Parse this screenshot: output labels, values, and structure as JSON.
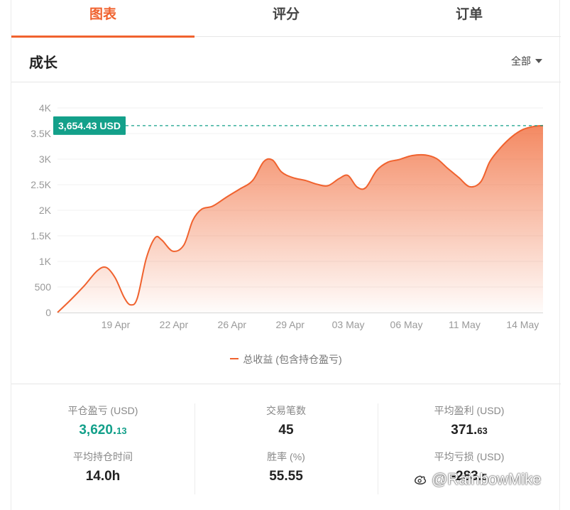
{
  "tabs": [
    {
      "label": "图表",
      "active": true
    },
    {
      "label": "评分",
      "active": false
    },
    {
      "label": "订单",
      "active": false
    }
  ],
  "section": {
    "title": "成长",
    "filter_label": "全部"
  },
  "highlight": {
    "label": "3,654.43 USD",
    "color": "#13a08a"
  },
  "colors": {
    "accent": "#f0622e",
    "positive": "#13a08a"
  },
  "chart_data": {
    "type": "area",
    "ylim": [
      0,
      4000
    ],
    "y_ticks": [
      {
        "v": 0,
        "label": "0"
      },
      {
        "v": 500,
        "label": "500"
      },
      {
        "v": 1000,
        "label": "1K"
      },
      {
        "v": 1500,
        "label": "1.5K"
      },
      {
        "v": 2000,
        "label": "2K"
      },
      {
        "v": 2500,
        "label": "2.5K"
      },
      {
        "v": 3000,
        "label": "3K"
      },
      {
        "v": 3500,
        "label": "3.5K"
      },
      {
        "v": 4000,
        "label": "4K"
      }
    ],
    "x_ticks": [
      "19 Apr",
      "22 Apr",
      "26 Apr",
      "29 Apr",
      "03 May",
      "06 May",
      "11 May",
      "14 May"
    ],
    "reference_value": 3654.43,
    "series": [
      {
        "name": "总收益 (包含持仓盈亏)",
        "points": [
          [
            0,
            0
          ],
          [
            0.3,
            250
          ],
          [
            0.6,
            520
          ],
          [
            0.9,
            820
          ],
          [
            1.1,
            880
          ],
          [
            1.3,
            680
          ],
          [
            1.5,
            300
          ],
          [
            1.65,
            150
          ],
          [
            1.8,
            280
          ],
          [
            2.0,
            1050
          ],
          [
            2.2,
            1460
          ],
          [
            2.35,
            1420
          ],
          [
            2.6,
            1200
          ],
          [
            2.85,
            1320
          ],
          [
            3.05,
            1800
          ],
          [
            3.25,
            2020
          ],
          [
            3.5,
            2080
          ],
          [
            3.8,
            2250
          ],
          [
            4.1,
            2410
          ],
          [
            4.4,
            2580
          ],
          [
            4.65,
            2950
          ],
          [
            4.85,
            2980
          ],
          [
            5.05,
            2750
          ],
          [
            5.3,
            2640
          ],
          [
            5.6,
            2580
          ],
          [
            5.85,
            2510
          ],
          [
            6.1,
            2480
          ],
          [
            6.35,
            2620
          ],
          [
            6.55,
            2680
          ],
          [
            6.75,
            2460
          ],
          [
            6.95,
            2440
          ],
          [
            7.2,
            2780
          ],
          [
            7.45,
            2940
          ],
          [
            7.7,
            2990
          ],
          [
            8.0,
            3070
          ],
          [
            8.3,
            3080
          ],
          [
            8.55,
            3010
          ],
          [
            8.8,
            2820
          ],
          [
            9.05,
            2640
          ],
          [
            9.3,
            2460
          ],
          [
            9.55,
            2560
          ],
          [
            9.75,
            2950
          ],
          [
            10.0,
            3230
          ],
          [
            10.25,
            3440
          ],
          [
            10.5,
            3580
          ],
          [
            10.75,
            3640
          ],
          [
            10.95,
            3654.43
          ]
        ]
      }
    ]
  },
  "stats": [
    [
      {
        "label": "平仓盈亏 (USD)",
        "int": "3,620.",
        "dec": "13",
        "color": "green"
      },
      {
        "label": "平均持仓时间",
        "int": "14.0h",
        "dec": "",
        "color": ""
      }
    ],
    [
      {
        "label": "交易笔数",
        "int": "45",
        "dec": "",
        "color": ""
      },
      {
        "label": "胜率 (%)",
        "int": "55.55",
        "dec": "",
        "color": ""
      }
    ],
    [
      {
        "label": "平均盈利 (USD)",
        "int": "371.",
        "dec": "63",
        "color": ""
      },
      {
        "label": "平均亏损 (USD)",
        "int": "-283.",
        "dec": "5",
        "color": ""
      }
    ]
  ],
  "watermark": {
    "text": "@RainbowMike",
    "icon": "weibo-icon"
  }
}
